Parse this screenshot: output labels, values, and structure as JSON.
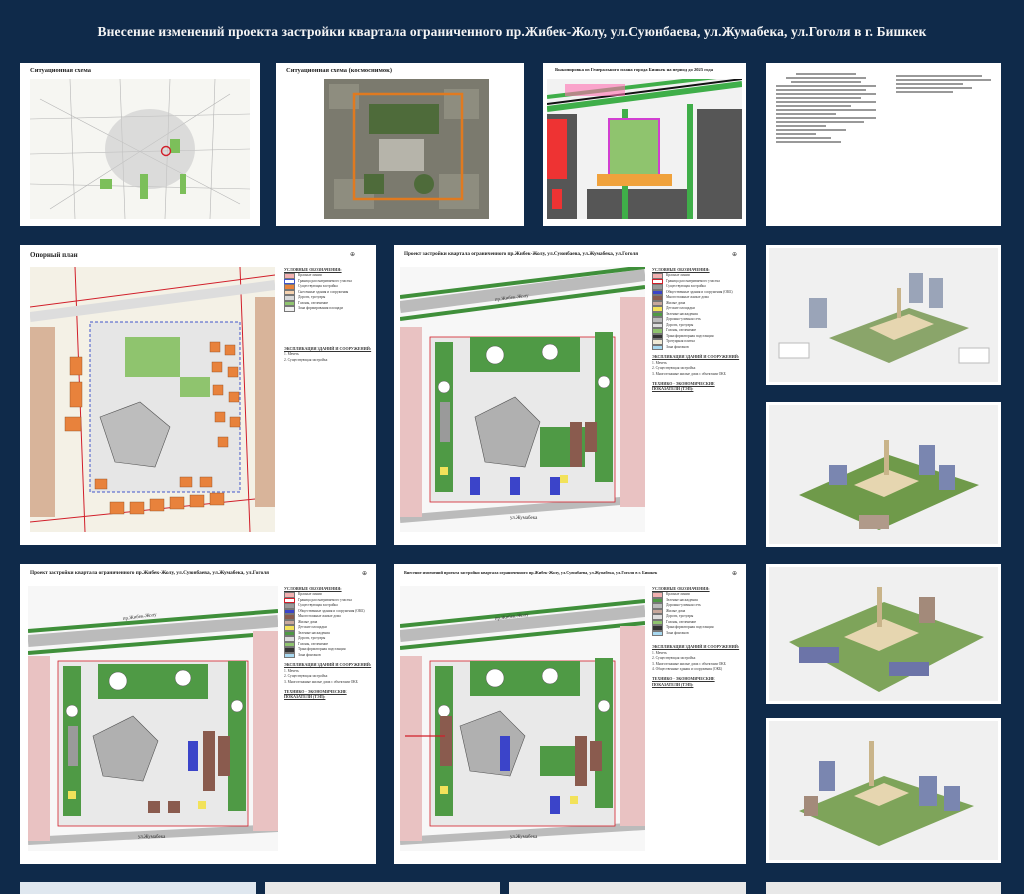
{
  "poster": {
    "title": "Внесение изменений проекта застройки квартала ограниченного пр.Жибек-Жолу,  ул.Суюнбаева, ул.Жумабека, ул.Гоголя в г. Бишкек"
  },
  "panels": {
    "situation": {
      "title": "Ситуационная схема"
    },
    "satellite": {
      "title": "Ситуационная схема (космоснимок)"
    },
    "genplan": {
      "title": "Выкопировка из Генерального плана города Бишкек на период до 2025 года"
    },
    "document": {
      "title": ""
    },
    "base_plan": {
      "title": "Опорный план",
      "legend_head": "УСЛОВНЫЕ ОБОЗНАЧЕНИЯ:",
      "legend": [
        "Красные линии",
        "Граница рассматриваемого участка",
        "Существующая застройка",
        "Снесенные здания и сооружения",
        "Дороги, тротуары",
        "Газоны, озеленение",
        "Зона формирования площади"
      ],
      "explication_head": "ЭКСПЛИКАЦИЯ ЗДАНИЙ И СООРУЖЕНИЙ:",
      "explication": [
        "1.  Мечеть",
        "2.  Существующая застройка"
      ]
    },
    "project1": {
      "title": "Проект застройки квартала ограниченного пр.Жибек-Жолу,  ул.Суюнбаева, ул.Жумабека, ул.Гоголя",
      "legend_head": "УСЛОВНЫЕ ОБОЗНАЧЕНИЯ:",
      "legend": [
        "Красные линии",
        "Граница рассматриваемого участка",
        "Существующая застройка",
        "Общественные здания и сооружения (ОКБ)",
        "Многоэтажные жилые дома",
        "Жилые дома",
        "Детские площадки",
        "Зеленые насаждения",
        "Дорожно-уличная сеть",
        "Дороги, тротуары",
        "Газоны, озеленение",
        "Трансформаторная подстанция",
        "Тротуарная плитка",
        "Зона фонтанов"
      ],
      "explication_head": "ЭКСПЛИКАЦИЯ ЗДАНИЙ И СООРУЖЕНИЙ:",
      "explication": [
        "1.  Мечеть",
        "2.  Существующая застройка",
        "3.  Многоэтажные жилые дома с объектами ОКБ"
      ],
      "tep_head": "ТЕХНИКО - ЭКОНОМИЧЕСКИЕ ПОКАЗАТЕЛИ (ТЭП):"
    },
    "project2": {
      "title": "Проект застройки квартала ограниченного пр.Жибек-Жолу,  ул.Суюнбаева, ул.Жумабека, ул.Гоголя",
      "legend_head": "УСЛОВНЫЕ ОБОЗНАЧЕНИЯ:",
      "legend": [
        "Красные линии",
        "Граница рассматриваемого участка",
        "Существующая застройка",
        "Общественные здания и сооружения (ОКБ)",
        "Многоэтажные жилые дома",
        "Жилые дома",
        "Детские площадки",
        "Зеленые насаждения",
        "Дороги, тротуары",
        "Газоны, озеленение",
        "Трансформаторная подстанция",
        "Зона фонтанов"
      ],
      "explication_head": "ЭКСПЛИКАЦИЯ ЗДАНИЙ И СООРУЖЕНИЙ:",
      "explication": [
        "1.  Мечеть",
        "2.  Существующая застройка",
        "3.  Многоэтажные жилые дома с объектами ОКБ"
      ],
      "tep_head": "ТЕХНИКО - ЭКОНОМИЧЕСКИЕ ПОКАЗАТЕЛИ (ТЭП):"
    },
    "project3": {
      "title": "Внесение изменений проекта застройки квартала ограниченного пр.Жибек-Жолу,  ул.Суюнбаева, ул.Жумабека, ул.Гоголя в г. Бишкек",
      "legend_head": "УСЛОВНЫЕ ОБОЗНАЧЕНИЯ:",
      "legend": [
        "Красные линии",
        "Зеленые насаждения",
        "Дорожно-уличная сеть",
        "Жилые дома",
        "Дороги, тротуары",
        "Газоны, озеленение",
        "Трансформаторная подстанция",
        "Зона фонтанов"
      ],
      "explication_head": "ЭКСПЛИКАЦИЯ ЗДАНИЙ И СООРУЖЕНИЙ:",
      "explication": [
        "1.  Мечеть",
        "2.  Существующая застройка",
        "3.  Многоэтажные жилые дома с объектами ОКБ",
        "4.  Общественные здания и сооружения (ОКБ)"
      ],
      "tep_head": "ТЕХНИКО - ЭКОНОМИЧЕСКИЕ ПОКАЗАТЕЛИ (ТЭП):"
    }
  },
  "map_labels": {
    "street_top": "пр.Жибек-Жолу",
    "street_bottom": "ул.Жумабека"
  },
  "colors": {
    "background": "#0f2a4a",
    "green": "#4f9a45",
    "blue_building": "#3b44c9",
    "brown_building": "#8a5b4e",
    "orange_existing": "#e8823c",
    "red_line": "#d11f2a"
  }
}
